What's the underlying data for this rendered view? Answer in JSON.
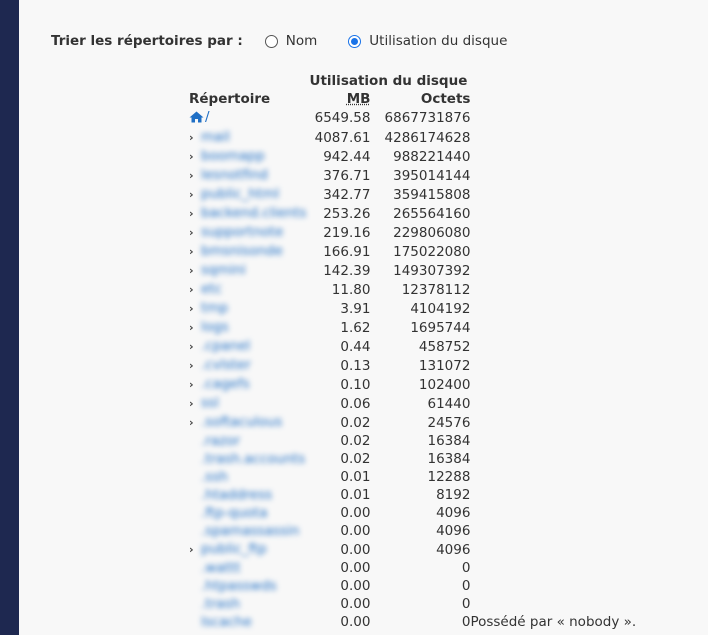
{
  "sort": {
    "label": "Trier les répertoires par :",
    "options": [
      {
        "label": "Nom",
        "checked": false
      },
      {
        "label": "Utilisation du disque",
        "checked": true
      }
    ]
  },
  "table": {
    "dir_header": "Répertoire",
    "usage_header": "Utilisation du disque",
    "mb_header": "MB",
    "octets_header": "Octets",
    "root": {
      "name": "/",
      "mb": "6549.58",
      "octets": "6867731876"
    },
    "rows": [
      {
        "name": "mail",
        "expandable": true,
        "mb": "4087.61",
        "octets": "4286174628"
      },
      {
        "name": "boomapp",
        "expandable": true,
        "mb": "942.44",
        "octets": "988221440"
      },
      {
        "name": "lesnotfind",
        "expandable": true,
        "mb": "376.71",
        "octets": "395014144"
      },
      {
        "name": "public_html",
        "expandable": true,
        "mb": "342.77",
        "octets": "359415808"
      },
      {
        "name": "backend.clients",
        "expandable": true,
        "mb": "253.26",
        "octets": "265564160"
      },
      {
        "name": "supportnote",
        "expandable": true,
        "mb": "219.16",
        "octets": "229806080"
      },
      {
        "name": "bmsnisonde",
        "expandable": true,
        "mb": "166.91",
        "octets": "175022080"
      },
      {
        "name": "sqmini",
        "expandable": true,
        "mb": "142.39",
        "octets": "149307392"
      },
      {
        "name": "etc",
        "expandable": true,
        "mb": "11.80",
        "octets": "12378112"
      },
      {
        "name": "tmp",
        "expandable": true,
        "mb": "3.91",
        "octets": "4104192"
      },
      {
        "name": "logs",
        "expandable": true,
        "mb": "1.62",
        "octets": "1695744"
      },
      {
        "name": ".cpanel",
        "expandable": true,
        "mb": "0.44",
        "octets": "458752"
      },
      {
        "name": ".cvlster",
        "expandable": true,
        "mb": "0.13",
        "octets": "131072"
      },
      {
        "name": ".cagefs",
        "expandable": true,
        "mb": "0.10",
        "octets": "102400"
      },
      {
        "name": "ssl",
        "expandable": true,
        "mb": "0.06",
        "octets": "61440"
      },
      {
        "name": ".softaculous",
        "expandable": true,
        "mb": "0.02",
        "octets": "24576"
      },
      {
        "name": ".razor",
        "expandable": false,
        "mb": "0.02",
        "octets": "16384"
      },
      {
        "name": ".trash.accounts",
        "expandable": false,
        "mb": "0.02",
        "octets": "16384"
      },
      {
        "name": ".ssh",
        "expandable": false,
        "mb": "0.01",
        "octets": "12288"
      },
      {
        "name": ".htaddress",
        "expandable": false,
        "mb": "0.01",
        "octets": "8192"
      },
      {
        "name": ".ftp-quota",
        "expandable": false,
        "mb": "0.00",
        "octets": "4096"
      },
      {
        "name": ".spamassassin",
        "expandable": false,
        "mb": "0.00",
        "octets": "4096"
      },
      {
        "name": "public_ftp",
        "expandable": true,
        "mb": "0.00",
        "octets": "4096"
      },
      {
        "name": ".wattt",
        "expandable": false,
        "mb": "0.00",
        "octets": "0"
      },
      {
        "name": ".htpasswds",
        "expandable": false,
        "mb": "0.00",
        "octets": "0"
      },
      {
        "name": ".trash",
        "expandable": false,
        "mb": "0.00",
        "octets": "0"
      },
      {
        "name": "lscache",
        "expandable": false,
        "mb": "0.00",
        "octets": "0",
        "note": "Possédé par « nobody »."
      }
    ]
  },
  "colors": {
    "sidebar": "#1e2850",
    "link": "#1f6fc5",
    "radio_accent": "#1a73e8"
  },
  "icons": {
    "home": "home-icon",
    "expand": "chevron-right-icon"
  }
}
